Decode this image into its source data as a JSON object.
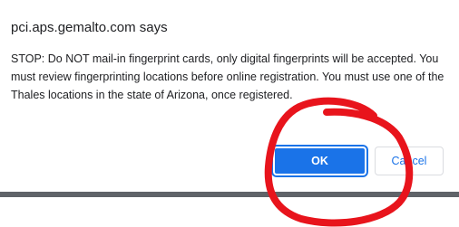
{
  "dialog": {
    "title": "pci.aps.gemalto.com says",
    "message": "STOP: Do NOT mail-in fingerprint cards, only digital fingerprints will be accepted.  You must review fingerprinting locations before online registration.  You must use one of the Thales locations in the state of Arizona, once registered.",
    "ok_label": "OK",
    "cancel_label": "Cancel"
  },
  "colors": {
    "accent": "#1a73e8",
    "annotation": "#e8141c",
    "bar": "#5f6368"
  }
}
